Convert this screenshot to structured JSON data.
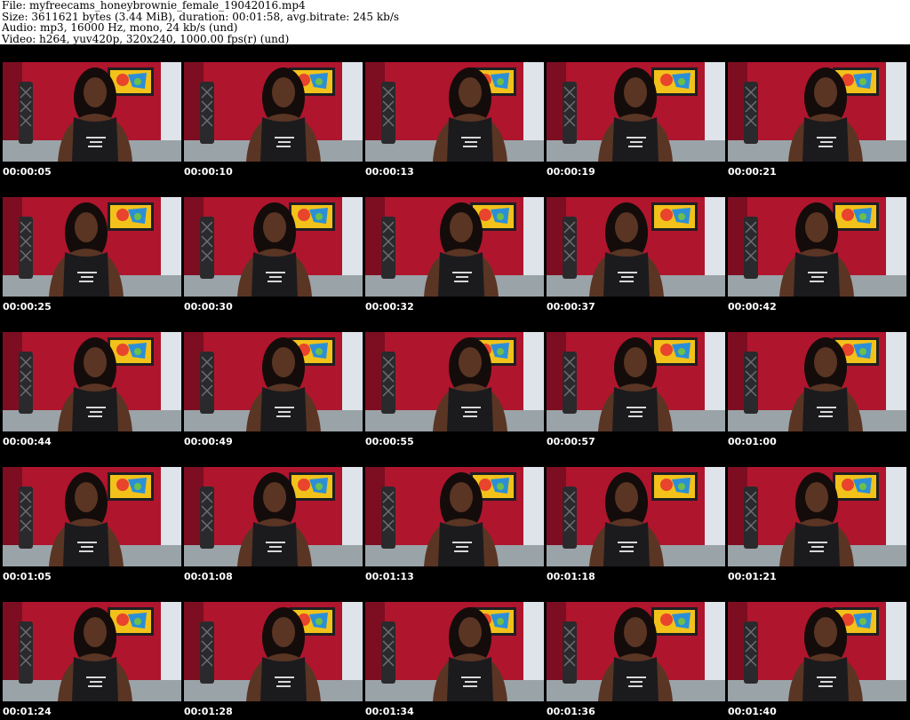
{
  "header": {
    "file_line": "File: myfreecams_honeybrownie_female_19042016.mp4",
    "size_line": "Size: 3611621 bytes (3.44 MiB), duration: 00:01:58, avg.bitrate: 245 kb/s",
    "audio_line": "Audio: mp3, 16000 Hz, mono, 24 kb/s (und)",
    "video_line": "Video: h264, yuv420p, 320x240, 1000.00 fps(r) (und)"
  },
  "thumbnails": [
    {
      "time": "00:00:05"
    },
    {
      "time": "00:00:10"
    },
    {
      "time": "00:00:13"
    },
    {
      "time": "00:00:19"
    },
    {
      "time": "00:00:21"
    },
    {
      "time": "00:00:25"
    },
    {
      "time": "00:00:30"
    },
    {
      "time": "00:00:32"
    },
    {
      "time": "00:00:37"
    },
    {
      "time": "00:00:42"
    },
    {
      "time": "00:00:44"
    },
    {
      "time": "00:00:49"
    },
    {
      "time": "00:00:55"
    },
    {
      "time": "00:00:57"
    },
    {
      "time": "00:01:00"
    },
    {
      "time": "00:01:05"
    },
    {
      "time": "00:01:08"
    },
    {
      "time": "00:01:13"
    },
    {
      "time": "00:01:18"
    },
    {
      "time": "00:01:21"
    },
    {
      "time": "00:01:24"
    },
    {
      "time": "00:01:28"
    },
    {
      "time": "00:01:34"
    },
    {
      "time": "00:01:36"
    },
    {
      "time": "00:01:40"
    }
  ],
  "colors": {
    "wall": "#b0152e",
    "wall_dark": "#7d0e22",
    "floor": "#9aa3a8",
    "window": "#dfe4ea",
    "skin": "#5a3524",
    "hair": "#140c0a",
    "top": "#1b1b1e",
    "painting_frame": "#1e1f22"
  }
}
